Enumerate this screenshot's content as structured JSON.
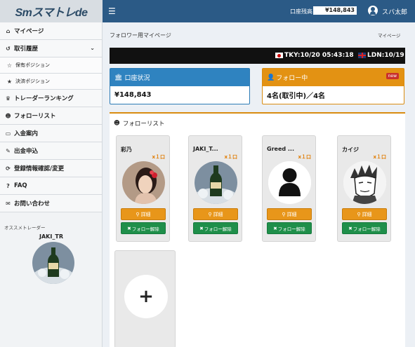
{
  "header": {
    "logo": "Smスマトレde",
    "menu_icon": "☰",
    "balance_label": "口座残高",
    "balance_value": "¥148,843",
    "user_name": "スバ太郎"
  },
  "sidebar": {
    "items": [
      {
        "label": "マイページ",
        "icon": "home-icon"
      },
      {
        "label": "取引履歴",
        "icon": "history-icon",
        "expanded": true
      },
      {
        "label": "保有ポジション",
        "icon": "star-outline-icon",
        "sub": true
      },
      {
        "label": "決済ポジション",
        "icon": "star-icon",
        "sub": true
      },
      {
        "label": "トレーダーランキング",
        "icon": "trophy-icon"
      },
      {
        "label": "フォローリスト",
        "icon": "users-icon"
      },
      {
        "label": "入金案内",
        "icon": "credit-card-icon"
      },
      {
        "label": "出金申込",
        "icon": "edit-icon"
      },
      {
        "label": "登録情報確認/変更",
        "icon": "refresh-icon"
      },
      {
        "label": "FAQ",
        "icon": "question-icon"
      },
      {
        "label": "お問い合わせ",
        "icon": "mail-icon"
      }
    ],
    "recommended_label": "オススメトレーダー",
    "recommended_trader": "JAKI_TR"
  },
  "page": {
    "title": "フォロワー用マイページ",
    "breadcrumb": "マイページ"
  },
  "clocks": {
    "tokyo": "TKY:10/20 05:43:18",
    "london": "LDN:10/19"
  },
  "account_panel": {
    "title": "口座状況",
    "value": "¥148,843",
    "color": "#2f83c0"
  },
  "follow_panel": {
    "title": "フォロー中",
    "badge": "new",
    "value": "4名(取引中)／4名",
    "color": "#e39213"
  },
  "follow_list": {
    "title": "フォローリスト",
    "detail_label": "詳細",
    "unfollow_label": "フォロー解除",
    "traders": [
      {
        "name": "彩乃",
        "ratio": "x１口",
        "avatar": "woman-photo"
      },
      {
        "name": "JAKI_T...",
        "ratio": "x１口",
        "avatar": "champagne-photo"
      },
      {
        "name": "Greed ...",
        "ratio": "x１口",
        "avatar": "default-user-silhouette"
      },
      {
        "name": "カイジ",
        "ratio": "x１口",
        "avatar": "manga-face-drawing"
      }
    ],
    "add_label": "+"
  }
}
